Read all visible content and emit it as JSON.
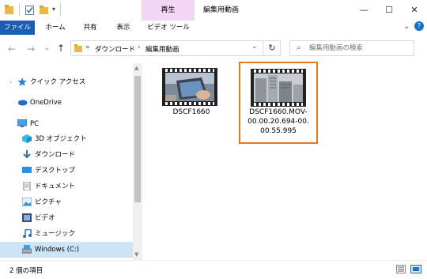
{
  "window": {
    "title": "編集用動画",
    "context_tab": "再生",
    "minimize": "—",
    "maximize": "☐",
    "close": "✕"
  },
  "ribbon": {
    "file": "ファイル",
    "tabs": [
      "ホーム",
      "共有",
      "表示",
      "ビデオ ツール"
    ],
    "expand": "⌄",
    "help": "?"
  },
  "address": {
    "breadcrumb_prefix": "«",
    "crumbs": [
      "ダウンロード",
      "編集用動画"
    ],
    "sep": "›",
    "dropdown": "⌄",
    "refresh": "↻"
  },
  "search": {
    "placeholder": "編集用動画の検索"
  },
  "nav": {
    "quick_access": "クイック アクセス",
    "onedrive": "OneDrive",
    "pc": "PC",
    "items": [
      "3D オブジェクト",
      "ダウンロード",
      "デスクトップ",
      "ドキュメント",
      "ピクチャ",
      "ビデオ",
      "ミュージック",
      "Windows (C:)"
    ]
  },
  "files": [
    {
      "name": "DSCF1660",
      "lines": [
        "DSCF1660"
      ]
    },
    {
      "name": "DSCF1660.MOV-00.00.20.694-00.00.55.995",
      "lines": [
        "DSCF1660.MOV-",
        "00.00.20.694-00.",
        "00.55.995"
      ]
    }
  ],
  "status": {
    "count": "2 個の項目"
  },
  "colors": {
    "accent": "#1a5fb4",
    "context_tab": "#f3d6f5",
    "selection_border": "#e87a1e",
    "nav_selected": "#cce4f7"
  }
}
